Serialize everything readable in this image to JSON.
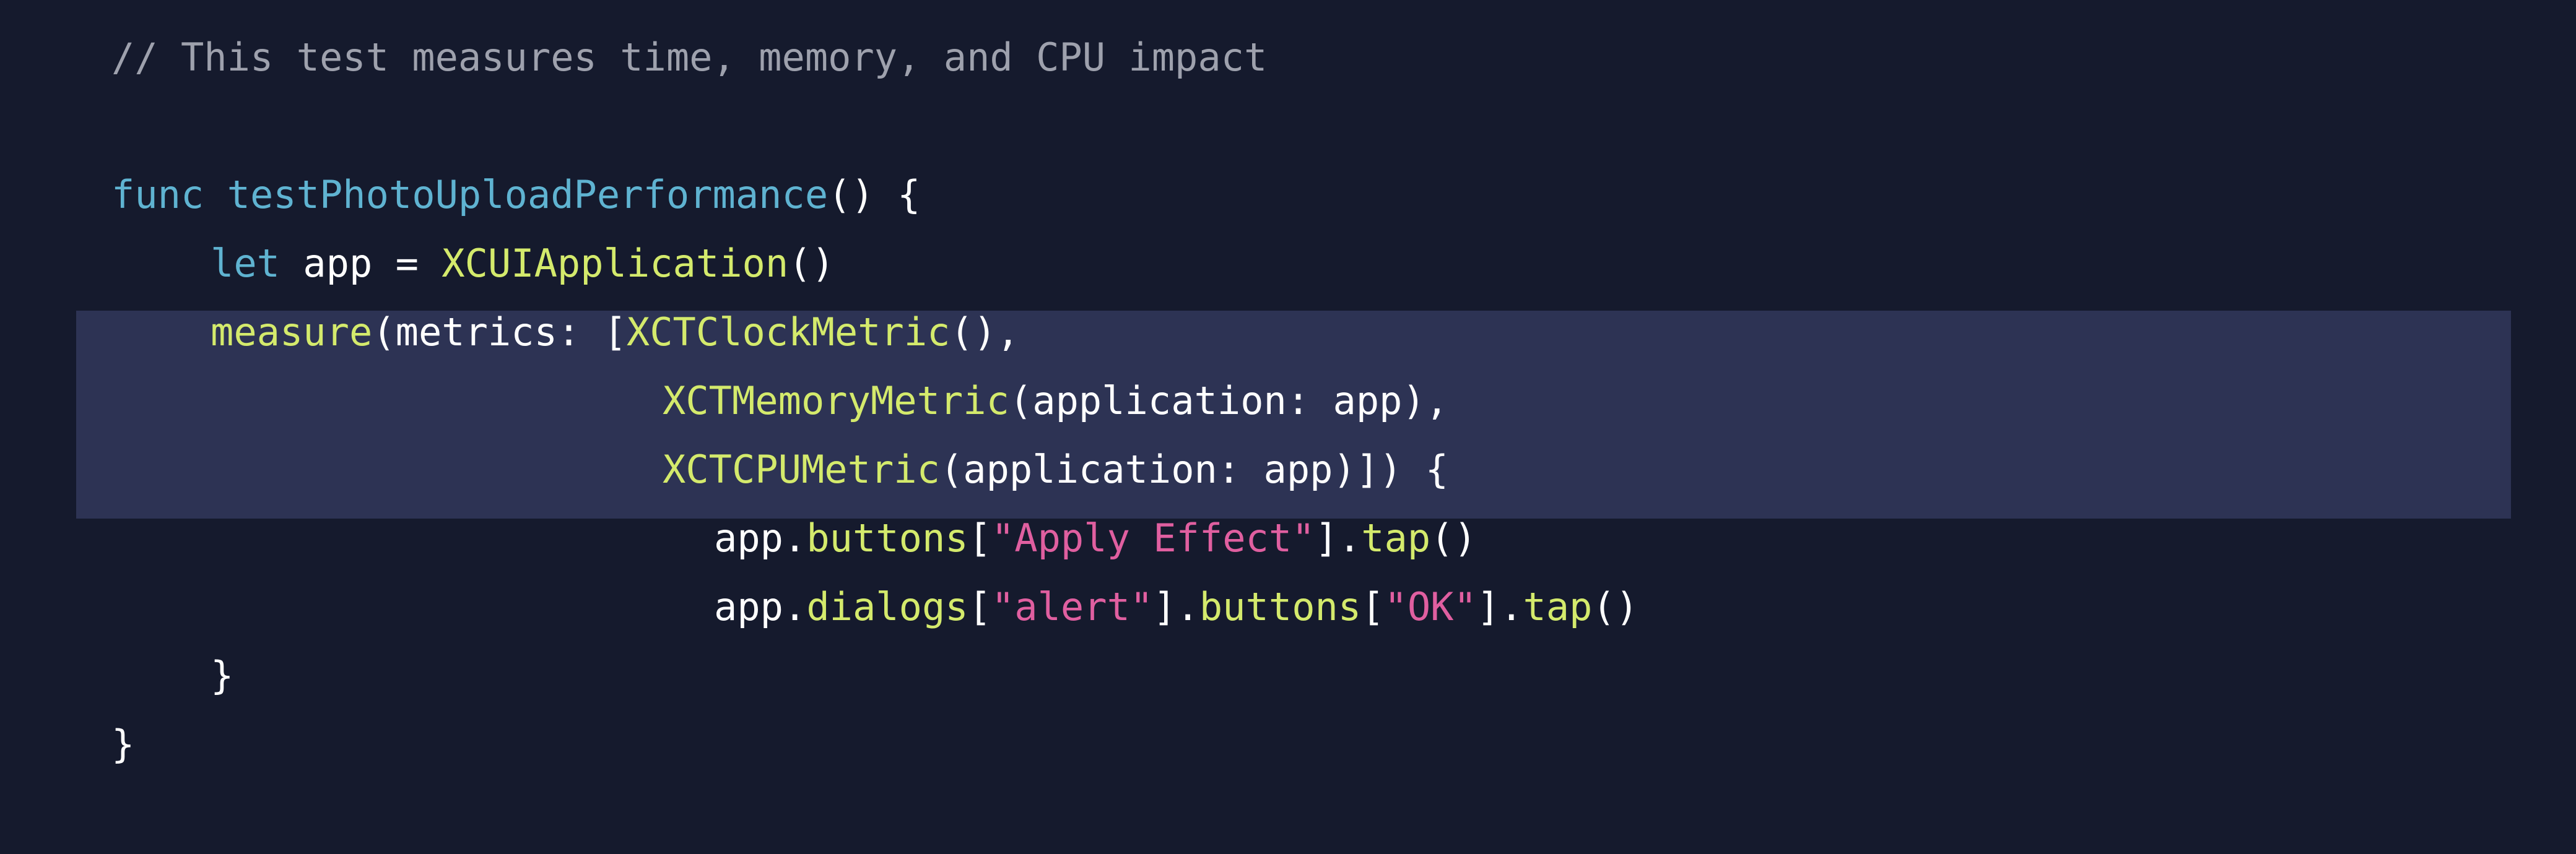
{
  "editor": {
    "highlighted_lines": [
      4,
      5,
      6
    ],
    "colors": {
      "background": "#151a2d",
      "highlight": "#2d3354",
      "comment": "#9ea1ad",
      "keyword": "#5fb3d1",
      "type_and_call": "#d4ea6c",
      "string": "#e05fa0",
      "plain": "#ffffff"
    },
    "lines": [
      {
        "tokens": [
          {
            "t": "// This test measures time, memory, and CPU impact",
            "c": "comment"
          }
        ]
      },
      {
        "tokens": []
      },
      {
        "tokens": [
          {
            "t": "func",
            "c": "kw"
          },
          {
            "t": " ",
            "c": "plain"
          },
          {
            "t": "testPhotoUploadPerformance",
            "c": "fn-def"
          },
          {
            "t": "() {",
            "c": "plain"
          }
        ]
      },
      {
        "tokens": [
          {
            "t": "let",
            "c": "kw"
          },
          {
            "t": " app = ",
            "c": "plain"
          },
          {
            "t": "XCUIApplication",
            "c": "type"
          },
          {
            "t": "()",
            "c": "plain"
          }
        ]
      },
      {
        "tokens": [
          {
            "t": "measure",
            "c": "call"
          },
          {
            "t": "(metrics: [",
            "c": "plain"
          },
          {
            "t": "XCTClockMetric",
            "c": "type"
          },
          {
            "t": "(),",
            "c": "plain"
          }
        ]
      },
      {
        "tokens": [
          {
            "t": "XCTMemoryMetric",
            "c": "type"
          },
          {
            "t": "(application: app),",
            "c": "plain"
          }
        ]
      },
      {
        "tokens": [
          {
            "t": "XCTCPUMetric",
            "c": "type"
          },
          {
            "t": "(application: app)]) {",
            "c": "plain"
          }
        ]
      },
      {
        "tokens": [
          {
            "t": "app.",
            "c": "plain"
          },
          {
            "t": "buttons",
            "c": "call"
          },
          {
            "t": "[",
            "c": "plain"
          },
          {
            "t": "\"Apply Effect\"",
            "c": "str"
          },
          {
            "t": "].",
            "c": "plain"
          },
          {
            "t": "tap",
            "c": "call"
          },
          {
            "t": "()",
            "c": "plain"
          }
        ]
      },
      {
        "tokens": [
          {
            "t": "app.",
            "c": "plain"
          },
          {
            "t": "dialogs",
            "c": "call"
          },
          {
            "t": "[",
            "c": "plain"
          },
          {
            "t": "\"alert\"",
            "c": "str"
          },
          {
            "t": "].",
            "c": "plain"
          },
          {
            "t": "buttons",
            "c": "call"
          },
          {
            "t": "[",
            "c": "plain"
          },
          {
            "t": "\"OK\"",
            "c": "str"
          },
          {
            "t": "].",
            "c": "plain"
          },
          {
            "t": "tap",
            "c": "call"
          },
          {
            "t": "()",
            "c": "plain"
          }
        ]
      },
      {
        "tokens": [
          {
            "t": "}",
            "c": "plain"
          }
        ]
      },
      {
        "tokens": [
          {
            "t": "}",
            "c": "plain"
          }
        ]
      }
    ]
  }
}
